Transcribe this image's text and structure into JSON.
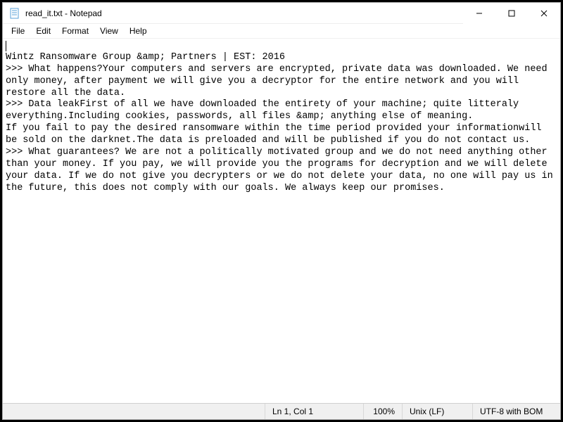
{
  "window": {
    "title": "read_it.txt - Notepad",
    "icon": "notepad-icon"
  },
  "menu": {
    "items": [
      "File",
      "Edit",
      "Format",
      "View",
      "Help"
    ]
  },
  "document": {
    "text": "\nWintz Ransomware Group &amp; Partners | EST: 2016\n>>> What happens?Your computers and servers are encrypted, private data was downloaded. We need only money, after payment we will give you a decryptor for the entire network and you will restore all the data.\n>>> Data leakFirst of all we have downloaded the entirety of your machine; quite litteraly everything.Including cookies, passwords, all files &amp; anything else of meaning.\nIf you fail to pay the desired ransomware within the time period provided your informationwill be sold on the darknet.The data is preloaded and will be published if you do not contact us.\n>>> What guarantees? We are not a politically motivated group and we do not need anything other than your money. If you pay, we will provide you the programs for decryption and we will delete your data. If we do not give you decrypters or we do not delete your data, no one will pay us in the future, this does not comply with our goals. We always keep our promises."
  },
  "status": {
    "lncol": "Ln 1, Col 1",
    "zoom": "100%",
    "eol": "Unix (LF)",
    "encoding": "UTF-8 with BOM"
  },
  "winbuttons": {
    "min": "—",
    "max": "☐",
    "close": "✕"
  }
}
